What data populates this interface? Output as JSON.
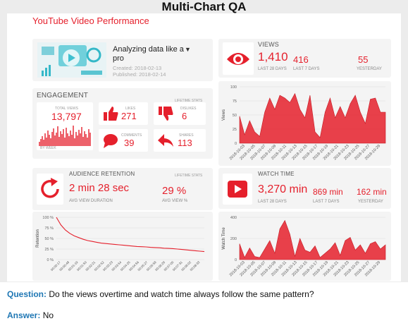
{
  "page_title": "Multi-Chart QA",
  "dashboard_title": "YouTube Video Performance",
  "video": {
    "title": "Analyzing data like a pro",
    "created": "Created: 2018-02-13",
    "published": "Published: 2018-02-14"
  },
  "views_card": {
    "label": "VIEWS",
    "main_value": "1,410",
    "main_caption": "LAST 28 DAYS",
    "week_value": "416",
    "week_caption": "LAST 7 DAYS",
    "yesterday_value": "55",
    "yesterday_caption": "YESTERDAY"
  },
  "engagement": {
    "label": "ENGAGEMENT",
    "lifetime": "LIFETIME STATS",
    "total_views_caption": "TOTAL VIEWS",
    "total_views": "13,797",
    "by_week_caption": "BY WEEK",
    "likes_caption": "LIKES",
    "likes": "271",
    "dislikes_caption": "DISLIKES",
    "dislikes": "6",
    "comments_caption": "COMMENTS",
    "comments": "39",
    "shares_caption": "SHARES",
    "shares": "113"
  },
  "retention": {
    "label": "AUDIENCE RETENTION",
    "lifetime": "LIFETIME STATS",
    "duration": "2 min 28 sec",
    "duration_caption": "AVG VIEW DURATION",
    "percent": "29 %",
    "percent_caption": "AVG VIEW %"
  },
  "watch_card": {
    "label": "WATCH TIME",
    "main_value": "3,270 min",
    "main_caption": "LAST 28 DAYS",
    "week_value": "869 min",
    "week_caption": "LAST 7 DAYS",
    "yesterday_value": "162 min",
    "yesterday_caption": "YESTERDAY"
  },
  "qa": {
    "question_label": "Question:",
    "question": "Do the views overtime and watch time always follow the same pattern?",
    "answer_label": "Answer:",
    "answer": "No"
  },
  "colors": {
    "accent": "#e5202c",
    "question": "#1f77b4"
  },
  "chart_data": [
    {
      "type": "area",
      "ylabel": "Views",
      "ylim": [
        0,
        100
      ],
      "yticks": [
        0,
        25,
        50,
        75,
        100
      ],
      "x": [
        "2018-10-02",
        "2018-10-03",
        "2018-10-04",
        "2018-10-05",
        "2018-10-06",
        "2018-10-07",
        "2018-10-08",
        "2018-10-09",
        "2018-10-10",
        "2018-10-11",
        "2018-10-12",
        "2018-10-13",
        "2018-10-14",
        "2018-10-15",
        "2018-10-16",
        "2018-10-17",
        "2018-10-18",
        "2018-10-19",
        "2018-10-20",
        "2018-10-21",
        "2018-10-22",
        "2018-10-23",
        "2018-10-24",
        "2018-10-25",
        "2018-10-26",
        "2018-10-27",
        "2018-10-28",
        "2018-10-29",
        "2018-10-30",
        "2018-10-31"
      ],
      "xtick_labels": [
        "2018-10-03",
        "2018-10-05",
        "2018-10-07",
        "2018-10-09",
        "2018-10-11",
        "2018-10-13",
        "2018-10-15",
        "2018-10-17",
        "2018-10-19",
        "2018-10-21",
        "2018-10-23",
        "2018-10-25",
        "2018-10-27",
        "2018-10-29"
      ],
      "values": [
        48,
        15,
        40,
        20,
        12,
        55,
        80,
        60,
        85,
        80,
        72,
        88,
        60,
        45,
        85,
        20,
        10,
        55,
        80,
        45,
        65,
        45,
        70,
        85,
        55,
        35,
        78,
        80,
        55,
        55
      ],
      "grid": true
    },
    {
      "type": "area",
      "ylabel": "Watch Time",
      "ylim": [
        0,
        400
      ],
      "yticks": [
        0,
        200,
        400
      ],
      "x": [
        "2018-10-02",
        "2018-10-03",
        "2018-10-04",
        "2018-10-05",
        "2018-10-06",
        "2018-10-07",
        "2018-10-08",
        "2018-10-09",
        "2018-10-10",
        "2018-10-11",
        "2018-10-12",
        "2018-10-13",
        "2018-10-14",
        "2018-10-15",
        "2018-10-16",
        "2018-10-17",
        "2018-10-18",
        "2018-10-19",
        "2018-10-20",
        "2018-10-21",
        "2018-10-22",
        "2018-10-23",
        "2018-10-24",
        "2018-10-25",
        "2018-10-26",
        "2018-10-27",
        "2018-10-28",
        "2018-10-29",
        "2018-10-30",
        "2018-10-31"
      ],
      "xtick_labels": [
        "2018-10-03",
        "2018-10-05",
        "2018-10-07",
        "2018-10-09",
        "2018-10-11",
        "2018-10-13",
        "2018-10-15",
        "2018-10-17",
        "2018-10-19",
        "2018-10-21",
        "2018-10-23",
        "2018-10-25",
        "2018-10-27",
        "2018-10-29"
      ],
      "values": [
        150,
        20,
        110,
        30,
        20,
        100,
        180,
        60,
        290,
        370,
        240,
        30,
        200,
        90,
        70,
        130,
        20,
        60,
        100,
        160,
        40,
        180,
        210,
        90,
        140,
        60,
        150,
        170,
        100,
        140
      ],
      "grid": true
    },
    {
      "type": "line",
      "ylabel": "Retention",
      "ylim": [
        0,
        100
      ],
      "yticks": [
        0,
        25,
        50,
        75,
        100
      ],
      "ytick_labels": [
        "0 %",
        "25 %",
        "50 %",
        "75 %",
        "100 %"
      ],
      "xtick_labels": [
        "00:00:17",
        "00:00:48",
        "00:01:19",
        "00:01:50",
        "00:02:21",
        "00:02:52",
        "00:03:23",
        "00:03:54",
        "00:04:25",
        "00:04:56",
        "00:05:27",
        "00:05:58",
        "00:06:29",
        "00:07:00",
        "00:07:31",
        "00:08:02",
        "00:08:33"
      ],
      "values": [
        100,
        82,
        70,
        62,
        56,
        52,
        48,
        45,
        43,
        41,
        39,
        38,
        37,
        36,
        35,
        34,
        33,
        32,
        31,
        30.5,
        30,
        29,
        28.5,
        28,
        27,
        26.5,
        26,
        25,
        24,
        23,
        22,
        21,
        20,
        19
      ],
      "grid": true
    }
  ]
}
